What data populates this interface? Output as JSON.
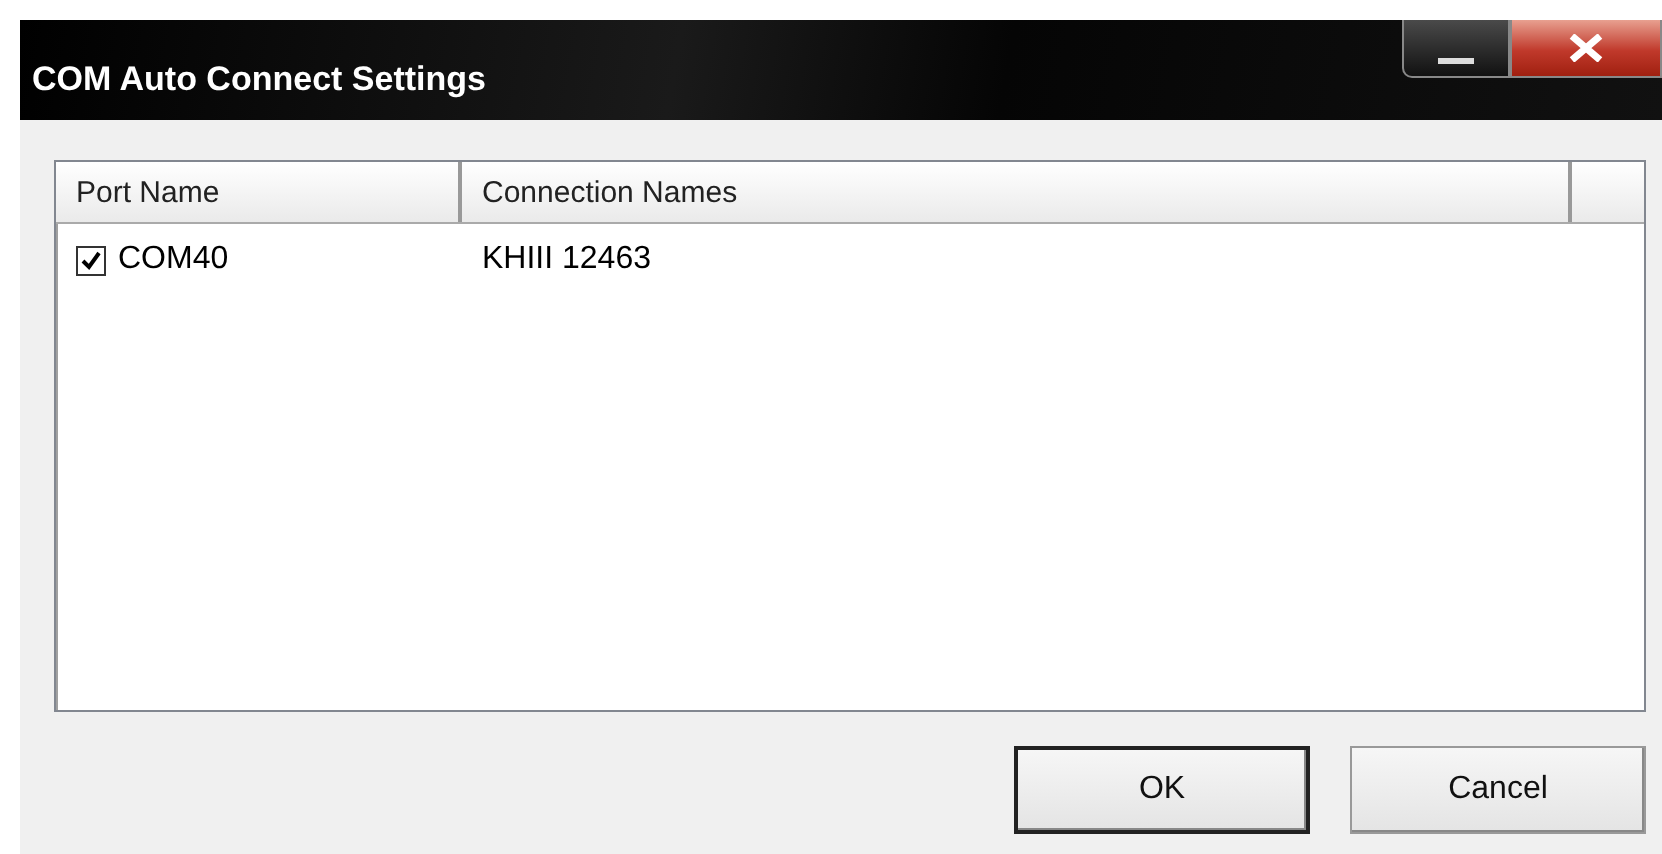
{
  "window": {
    "title": "COM Auto Connect Settings"
  },
  "table": {
    "columns": [
      "Port Name",
      "Connection Names"
    ],
    "rows": [
      {
        "port": "COM40",
        "checked": true,
        "connection": "KHIII 12463"
      }
    ]
  },
  "buttons": [
    {
      "label": "OK",
      "default": true
    },
    {
      "label": "Cancel",
      "default": false
    }
  ]
}
